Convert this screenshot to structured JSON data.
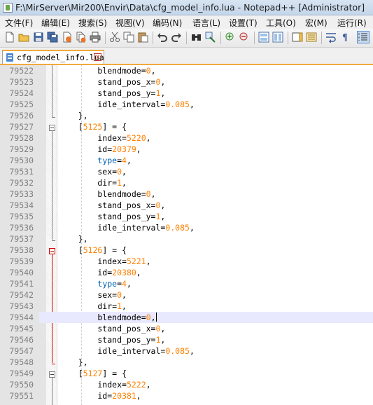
{
  "window": {
    "title": "F:\\MirServer\\Mir200\\Envir\\Data\\cfg_model_info.lua - Notepad++ [Administrator]"
  },
  "menu": [
    "文件(F)",
    "编辑(E)",
    "搜索(S)",
    "视图(V)",
    "编码(N)",
    "语言(L)",
    "设置(T)",
    "工具(O)",
    "宏(M)",
    "运行(R)"
  ],
  "toolbar": {
    "buttons": [
      "new-file-icon",
      "open-file-icon",
      "save-icon",
      "save-all-icon",
      "close-icon",
      "close-all-icon",
      "print-icon",
      "cut-icon",
      "copy-icon",
      "paste-icon",
      "undo-icon",
      "redo-icon",
      "find-icon",
      "replace-icon",
      "zoom-in-icon",
      "zoom-out-icon",
      "sync-vertical-icon",
      "sync-horizontal-icon",
      "word-wrap-icon",
      "show-all-chars-icon",
      "indent-guide-icon"
    ]
  },
  "tab": {
    "label": "cfg_model_info.lua",
    "close_glyph": "×"
  },
  "editor": {
    "current_line": "79544",
    "lines": [
      {
        "n": "79522",
        "text": "blendmode=0,"
      },
      {
        "n": "79523",
        "text": "stand_pos_x=0,"
      },
      {
        "n": "79524",
        "text": "stand_pos_y=1,"
      },
      {
        "n": "79525",
        "text": "idle_interval=0.085,"
      },
      {
        "n": "79526",
        "text": "},"
      },
      {
        "n": "79527",
        "text": "[5125] = {"
      },
      {
        "n": "79528",
        "text": "index=5220,"
      },
      {
        "n": "79529",
        "text": "id=20379,"
      },
      {
        "n": "79530",
        "text": "type=4,"
      },
      {
        "n": "79531",
        "text": "sex=0,"
      },
      {
        "n": "79532",
        "text": "dir=1,"
      },
      {
        "n": "79533",
        "text": "blendmode=0,"
      },
      {
        "n": "79534",
        "text": "stand_pos_x=0,"
      },
      {
        "n": "79535",
        "text": "stand_pos_y=1,"
      },
      {
        "n": "79536",
        "text": "idle_interval=0.085,"
      },
      {
        "n": "79537",
        "text": "},"
      },
      {
        "n": "79538",
        "text": "[5126] = {"
      },
      {
        "n": "79539",
        "text": "index=5221,"
      },
      {
        "n": "79540",
        "text": "id=20380,"
      },
      {
        "n": "79541",
        "text": "type=4,"
      },
      {
        "n": "79542",
        "text": "sex=0,"
      },
      {
        "n": "79543",
        "text": "dir=1,"
      },
      {
        "n": "79544",
        "text": "blendmode=0,"
      },
      {
        "n": "79545",
        "text": "stand_pos_x=0,"
      },
      {
        "n": "79546",
        "text": "stand_pos_y=1,"
      },
      {
        "n": "79547",
        "text": "idle_interval=0.085,"
      },
      {
        "n": "79548",
        "text": "},"
      },
      {
        "n": "79549",
        "text": "[5127] = {"
      },
      {
        "n": "79550",
        "text": "index=5222,"
      },
      {
        "n": "79551",
        "text": "id=20381,"
      }
    ]
  }
}
